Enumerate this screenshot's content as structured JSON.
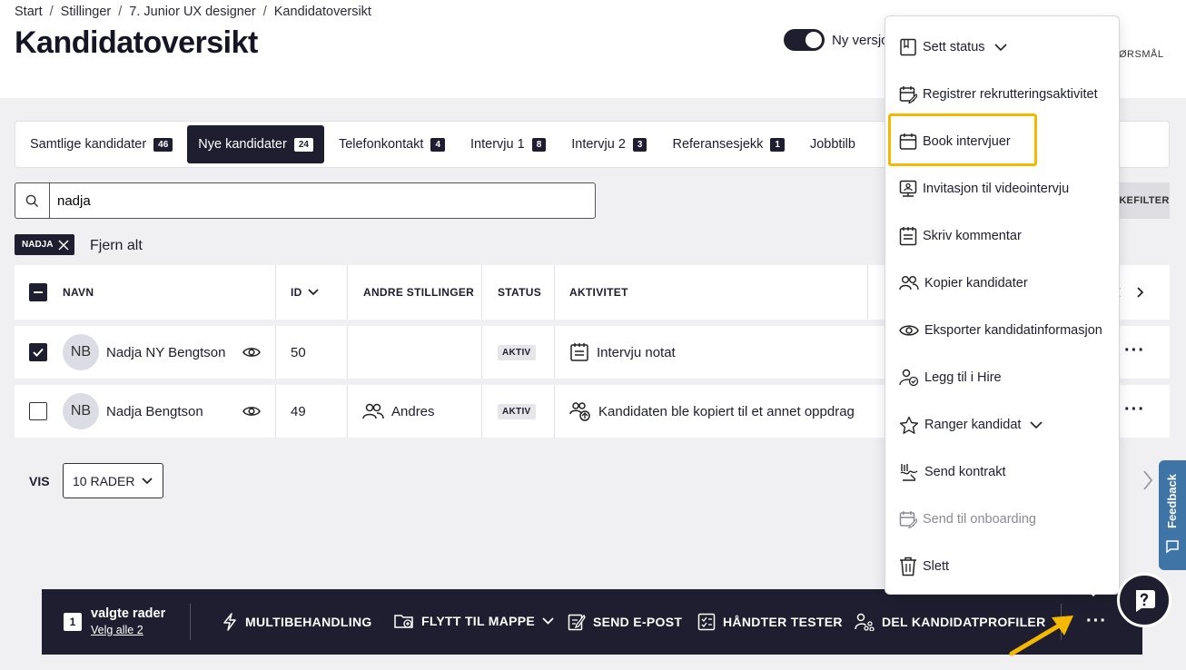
{
  "breadcrumb": [
    "Start",
    "Stillinger",
    "7. Junior UX designer",
    "Kandidatoversikt"
  ],
  "breadcrumb_separator": "/",
  "page_title": "Kandidatoversikt",
  "toggle": {
    "label": "Ny versjon",
    "on": true
  },
  "header_right_label": "ØRSMÅL",
  "tabs": [
    {
      "label": "Samtlige kandidater",
      "count": "46"
    },
    {
      "label": "Nye kandidater",
      "count": "24"
    },
    {
      "label": "Telefonkontakt",
      "count": "4"
    },
    {
      "label": "Intervju 1",
      "count": "8"
    },
    {
      "label": "Intervju 2",
      "count": "3"
    },
    {
      "label": "Referansesjekk",
      "count": "1"
    },
    {
      "label": "Jobbtilb",
      "count": ""
    }
  ],
  "search": {
    "value": "nadja"
  },
  "filter_button": "KEFILTER",
  "active_filter_chip": "NADJA",
  "clear_all": "Fjern alt",
  "table": {
    "headers": {
      "name": "NAVN",
      "id": "ID",
      "other_positions": "ANDRE STILLINGER",
      "status": "STATUS",
      "activity": "AKTIVITET"
    },
    "rows": [
      {
        "initials": "NB",
        "name": "Nadja NY Bengtson",
        "id": "50",
        "other_positions": "",
        "status": "AKTIV",
        "activity": "Intervju notat",
        "checked": true
      },
      {
        "initials": "NB",
        "name": "Nadja Bengtson",
        "id": "49",
        "other_positions": "Andres",
        "status": "AKTIV",
        "activity": "Kandidaten ble kopiert til et annet oppdrag",
        "checked": false
      }
    ]
  },
  "pagination": {
    "vis_label": "VIS",
    "rows_per_page": "10 RADER"
  },
  "bottom_bar": {
    "selected_count": "1",
    "selected_label": "valgte rader",
    "select_all_link": "Velg alle 2",
    "actions": [
      "MULTIBEHANDLING",
      "FLYTT TIL MAPPE",
      "SEND E-POST",
      "HÅNDTER TESTER",
      "DEL KANDIDATPROFILER"
    ]
  },
  "menu": {
    "items": [
      {
        "label": "Sett status",
        "icon": "flag-icon",
        "has_chevron": true,
        "disabled": false
      },
      {
        "label": "Registrer rekrutteringsaktivitet",
        "icon": "calendar-edit-icon",
        "has_chevron": false,
        "disabled": false
      },
      {
        "label": "Book intervjuer",
        "icon": "calendar-icon",
        "has_chevron": false,
        "disabled": false
      },
      {
        "label": "Invitasjon til videointervju",
        "icon": "video-person-icon",
        "has_chevron": false,
        "disabled": false
      },
      {
        "label": "Skriv kommentar",
        "icon": "notepad-icon",
        "has_chevron": false,
        "disabled": false
      },
      {
        "label": "Kopier kandidater",
        "icon": "users-icon",
        "has_chevron": false,
        "disabled": false
      },
      {
        "label": "Eksporter kandidatinformasjon",
        "icon": "eye-icon",
        "has_chevron": false,
        "disabled": false
      },
      {
        "label": "Legg til i Hire",
        "icon": "person-check-icon",
        "has_chevron": false,
        "disabled": false
      },
      {
        "label": "Ranger kandidat",
        "icon": "star-icon",
        "has_chevron": true,
        "disabled": false
      },
      {
        "label": "Send kontrakt",
        "icon": "signature-icon",
        "has_chevron": false,
        "disabled": false
      },
      {
        "label": "Send til onboarding",
        "icon": "calendar-edit-icon",
        "has_chevron": false,
        "disabled": true
      },
      {
        "label": "Slett",
        "icon": "trash-icon",
        "has_chevron": false,
        "disabled": false
      }
    ]
  },
  "feedback_label": "Feedback",
  "colors": {
    "dark": "#1e1e30",
    "highlight": "#f5b800",
    "feedback": "#3e74a6"
  }
}
